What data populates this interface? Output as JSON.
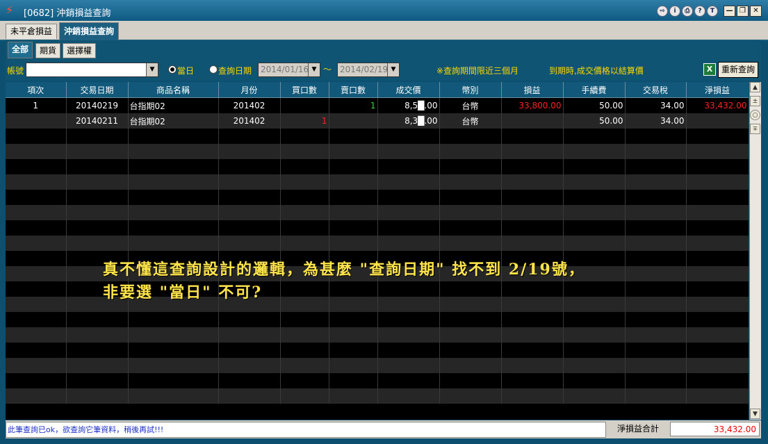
{
  "window": {
    "title": "[0682] 沖銷損益查詢",
    "circle_buttons": [
      "⇨",
      "i",
      "⎙",
      "?",
      "T"
    ],
    "controls": [
      "—",
      "❐",
      "✕"
    ]
  },
  "outer_tabs": [
    {
      "label": "未平倉損益",
      "active": false
    },
    {
      "label": "沖銷損益查詢",
      "active": true
    }
  ],
  "inner_tabs": [
    {
      "label": "全部",
      "active": true
    },
    {
      "label": "期貨",
      "active": false
    },
    {
      "label": "選擇權",
      "active": false
    }
  ],
  "filter": {
    "account_label": "帳號",
    "account_value": "",
    "radio_today_label": "當日",
    "radio_range_label": "查詢日期",
    "date_from": "2014/01/16",
    "tilde": "～",
    "date_to": "2014/02/19",
    "note1": "※查詢期間限近三個月",
    "note2": "到期時,成交價格以結算價",
    "excel_icon": "X",
    "requery_label": "重新查詢"
  },
  "table": {
    "columns": [
      "項次",
      "交易日期",
      "商品名稱",
      "月份",
      "買口數",
      "賣口數",
      "成交價",
      "幣別",
      "損益",
      "手續費",
      "交易稅",
      "淨損益"
    ],
    "rows": [
      [
        "1",
        "20140219",
        "台指期02",
        "201402",
        "",
        "1",
        "8,5█.00",
        "台幣",
        "33,800.00",
        "50.00",
        "34.00",
        "33,432.00"
      ],
      [
        "",
        "20140211",
        "台指期02",
        "201402",
        "1",
        "",
        "8,3█.00",
        "台幣",
        "",
        "50.00",
        "34.00",
        ""
      ]
    ],
    "empty_rows": 18
  },
  "overlay": {
    "line1": "真不懂這查詢設計的邏輯，為甚麼 \"查詢日期\" 找不到 2/19號，",
    "line2": "非要選 \"當日\" 不可?"
  },
  "status": {
    "message": "此筆查詢已ok，欲查詢它筆資料，稍後再試!!!",
    "sum_label": "淨損益合計",
    "sum_value": "33,432.00"
  }
}
